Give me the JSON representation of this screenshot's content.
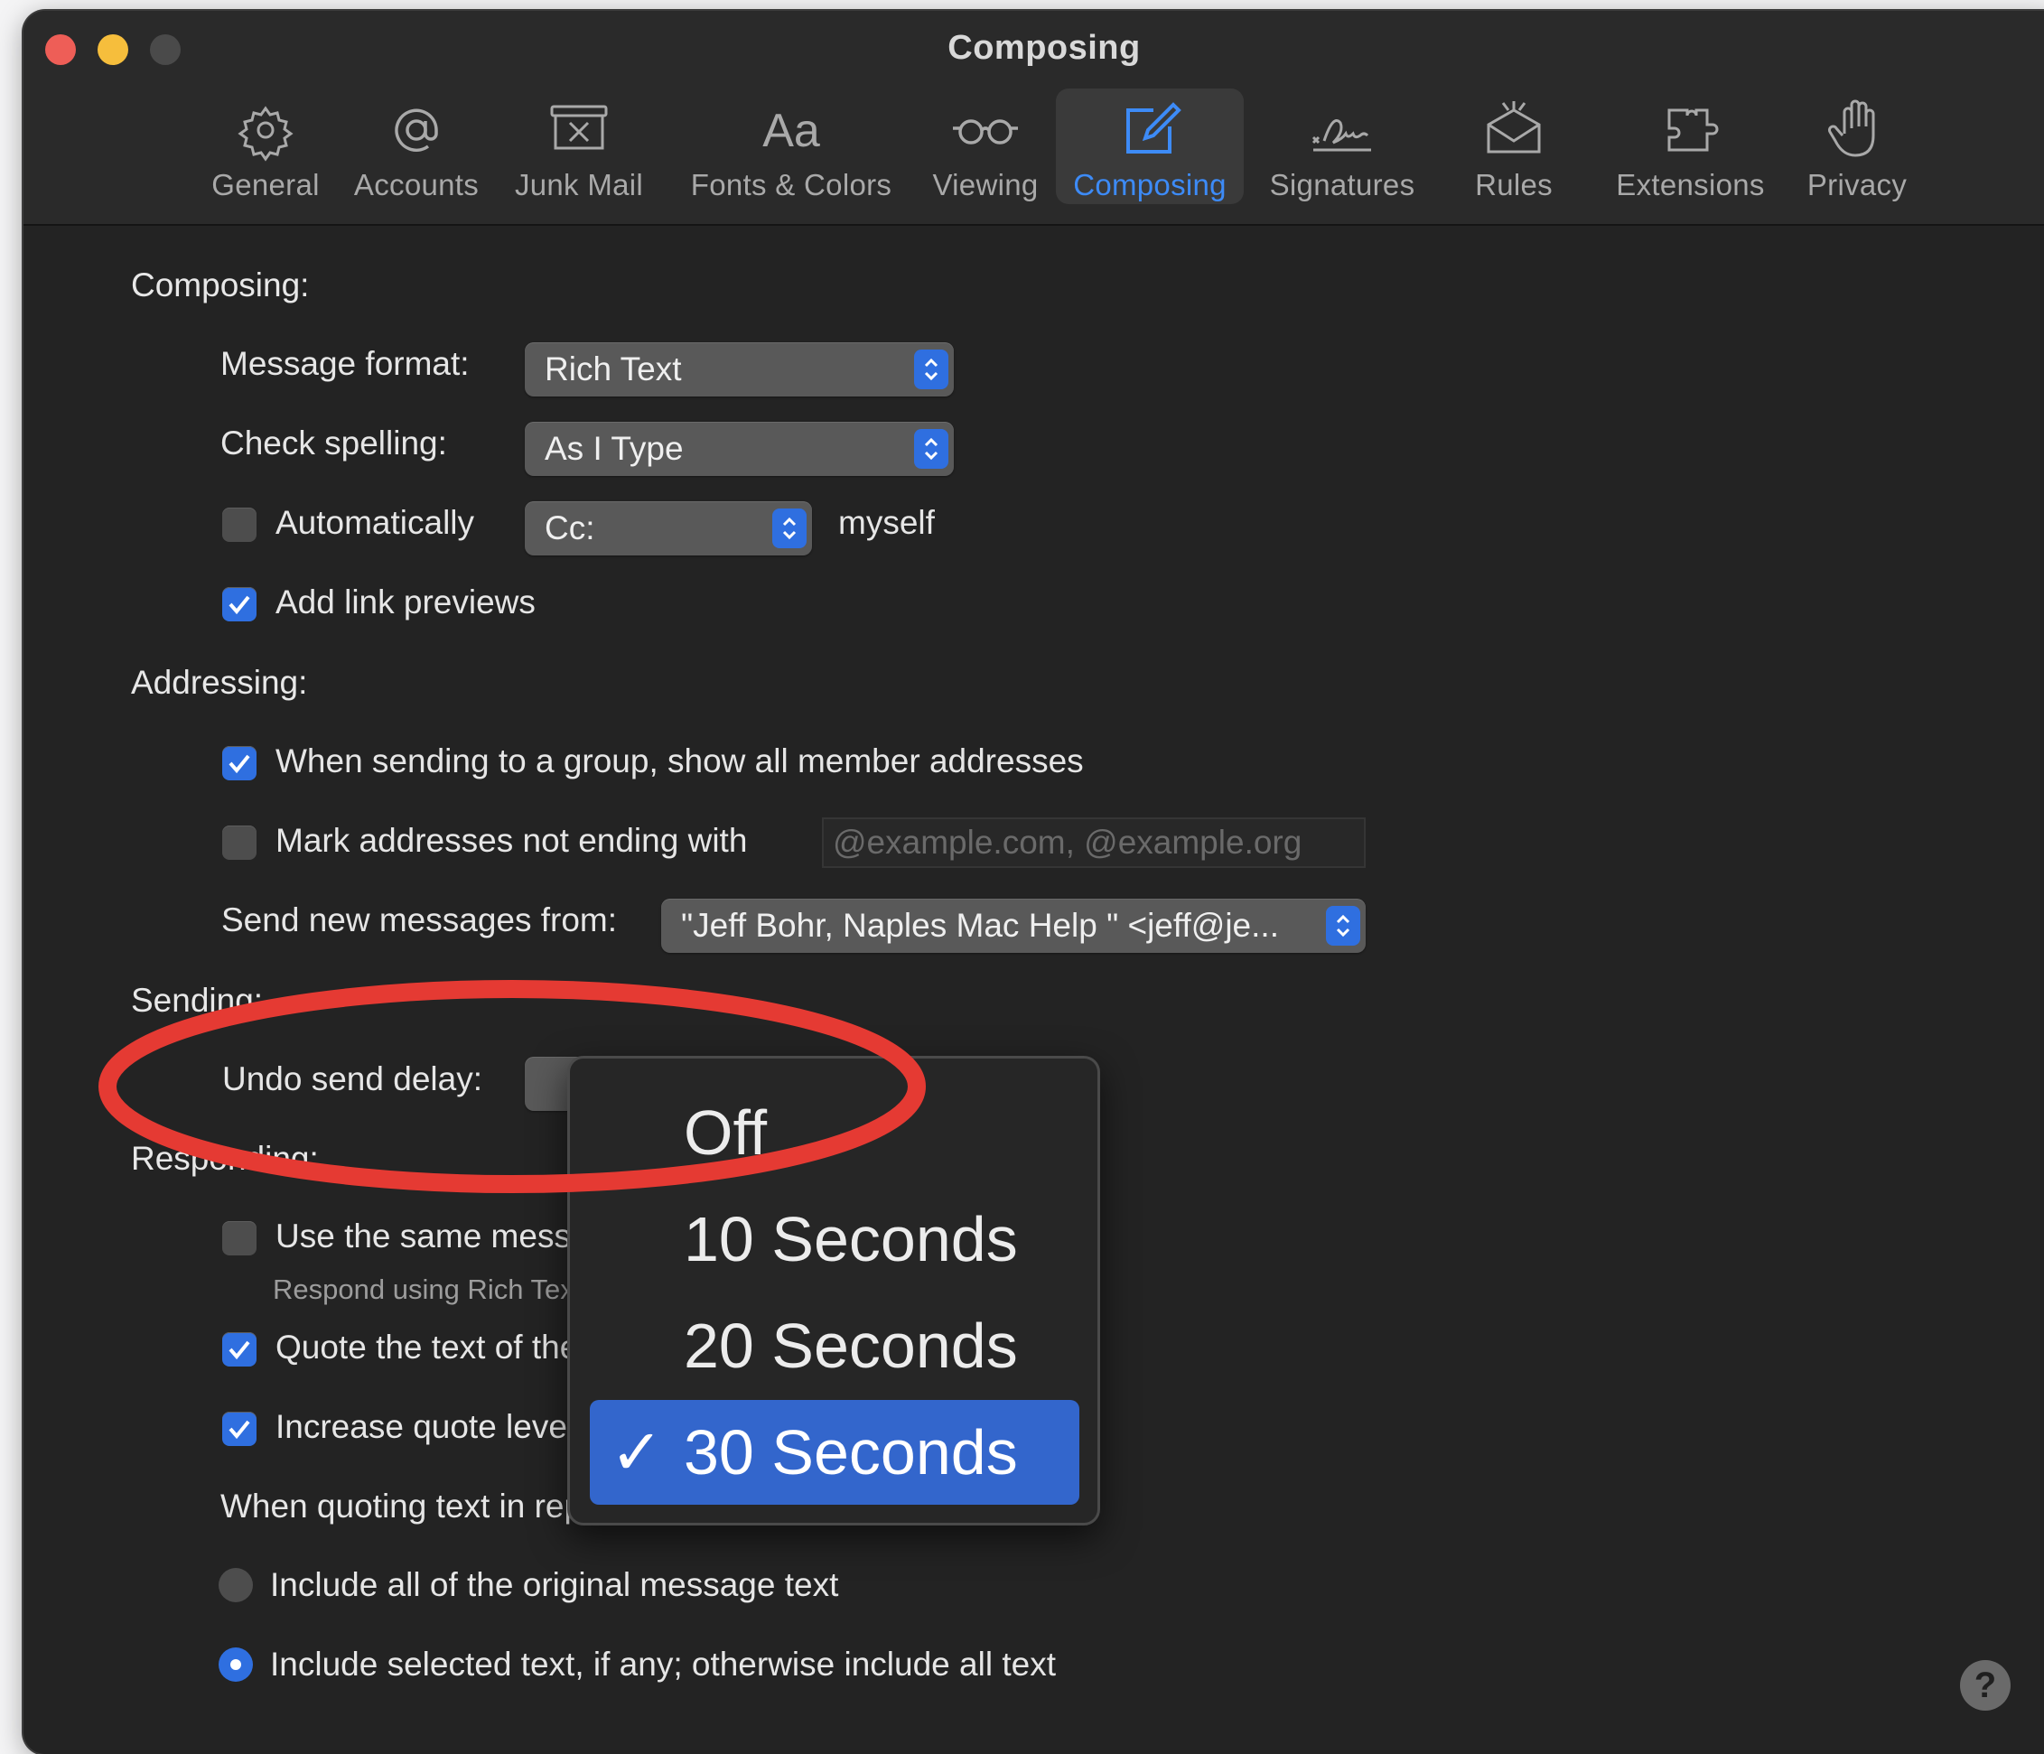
{
  "window": {
    "title": "Composing"
  },
  "toolbar": {
    "tabs": [
      {
        "label": "General",
        "icon": "gear-icon"
      },
      {
        "label": "Accounts",
        "icon": "at-sign-icon"
      },
      {
        "label": "Junk Mail",
        "icon": "junk-bin-icon"
      },
      {
        "label": "Fonts & Colors",
        "icon": "font-aa-icon"
      },
      {
        "label": "Viewing",
        "icon": "glasses-icon"
      },
      {
        "label": "Composing",
        "icon": "compose-pencil-icon",
        "active": true
      },
      {
        "label": "Signatures",
        "icon": "signature-icon"
      },
      {
        "label": "Rules",
        "icon": "rules-envelope-icon"
      },
      {
        "label": "Extensions",
        "icon": "puzzle-piece-icon"
      },
      {
        "label": "Privacy",
        "icon": "hand-icon"
      }
    ]
  },
  "composing": {
    "heading": "Composing:",
    "message_format_label": "Message format:",
    "message_format_value": "Rich Text",
    "check_spelling_label": "Check spelling:",
    "check_spelling_value": "As I Type",
    "auto_label": "Automatically",
    "auto_checked": false,
    "auto_value": "Cc:",
    "auto_suffix": "myself",
    "link_previews_label": "Add link previews",
    "link_previews_checked": true
  },
  "addressing": {
    "heading": "Addressing:",
    "group_label": "When sending to a group, show all member addresses",
    "group_checked": true,
    "mark_label": "Mark addresses not ending with",
    "mark_checked": false,
    "mark_placeholder": "@example.com, @example.org",
    "send_from_label": "Send new messages from:",
    "send_from_value": "\"Jeff Bohr, Naples Mac Help \" <jeff@je..."
  },
  "sending": {
    "heading": "Sending:",
    "undo_label": "Undo send delay:"
  },
  "responding": {
    "heading": "Responding:",
    "same_format_label": "Use the same message format as the original message",
    "same_format_checked": false,
    "same_format_sub": "Respond using Rich Text or Plain Text",
    "quote_label": "Quote the text of the original message",
    "quote_checked": true,
    "increase_label": "Increase quote level",
    "increase_checked": true,
    "quoting_label": "When quoting text in replies or forwards:",
    "include_all_label": "Include all of the original message text",
    "include_all_selected": false,
    "include_selected_label": "Include selected text, if any; otherwise include all text",
    "include_selected_selected": true
  },
  "undo_menu": {
    "options": [
      "Off",
      "10 Seconds",
      "20 Seconds",
      "30 Seconds"
    ],
    "selected": "30 Seconds",
    "check_glyph": "✓"
  },
  "help": {
    "label": "?"
  },
  "colors": {
    "accent": "#3d8bf7",
    "selection": "#3366cc",
    "annotation": "#e53a33",
    "close": "#ee5e57",
    "minimize": "#f6be3c"
  }
}
